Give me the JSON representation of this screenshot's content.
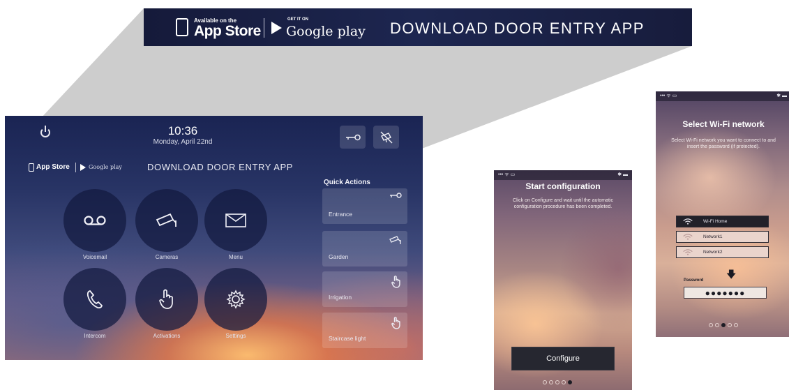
{
  "banner": {
    "appstore_small": "Available on the",
    "appstore_name": "App Store",
    "googleplay_small": "GET IT ON",
    "googleplay_name": "Google play",
    "download_text": "DOWNLOAD DOOR ENTRY APP"
  },
  "device": {
    "time": "10:36",
    "date": "Monday, April 22nd",
    "appstore_name": "App Store",
    "googleplay_name": "Google play",
    "download_text": "DOWNLOAD DOOR ENTRY APP",
    "top_icons": [
      "lock-key-icon",
      "camera-off-icon"
    ],
    "circles": [
      {
        "label": "Voicemail",
        "icon": "voicemail-icon"
      },
      {
        "label": "Cameras",
        "icon": "camera-icon"
      },
      {
        "label": "Menu",
        "icon": "envelope-icon"
      },
      {
        "label": "Intercom",
        "icon": "phone-icon"
      },
      {
        "label": "Activations",
        "icon": "hand-pointer-icon"
      },
      {
        "label": "Settings",
        "icon": "gear-icon"
      }
    ],
    "quick_actions_title": "Quick Actions",
    "quick_actions": [
      {
        "label": "Entrance",
        "icon": "key-icon"
      },
      {
        "label": "Garden",
        "icon": "camera-icon"
      },
      {
        "label": "Irrigation",
        "icon": "hand-pointer-icon"
      },
      {
        "label": "Staircase light",
        "icon": "hand-pointer-icon"
      }
    ]
  },
  "phone1": {
    "title": "Start configuration",
    "description": "Click on Configure and wait until the automatic configuration procedure has been completed.",
    "button": "Configure",
    "page_index": 4,
    "page_count": 5
  },
  "phone2": {
    "title": "Select Wi-Fi network",
    "description": "Select Wi-Fi network you want to connect to and insert the password (if protected).",
    "networks": [
      "Wi-Fi Home",
      "Network1",
      "Network2"
    ],
    "password_label": "Password",
    "password_value": "●●●●●●●",
    "page_index": 3,
    "page_count": 5
  },
  "colors": {
    "banner_bg": "#1d2650",
    "phone_button": "#262730"
  }
}
